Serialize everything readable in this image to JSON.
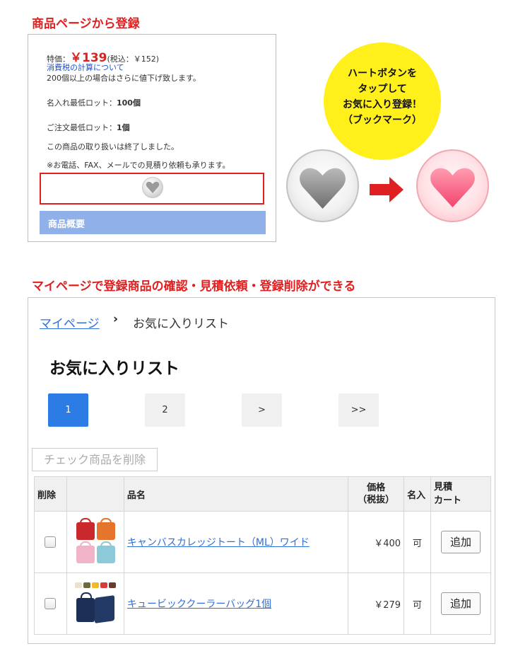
{
  "section1": {
    "heading": "商品ページから登録"
  },
  "product": {
    "price_label": "特価：",
    "price_value": "￥139",
    "price_tax": "(税込：￥152)",
    "tax_link": "消費税の計算について",
    "discount_note": "200個以上の場合はさらに値下げ致します。",
    "min_lot_name_label": "名入れ最低ロット：",
    "min_lot_name_value": "100個",
    "min_lot_order_label": "ご注文最低ロット：",
    "min_lot_order_value": "1個",
    "discontinued": "この商品の取り扱いは終了しました。",
    "estimate_note": "※お電話、FAX、メールでの見積り依頼も承ります。",
    "overview_label": "商品概要"
  },
  "callout": {
    "lines": [
      "ハートボタンを",
      "タップして",
      "お気に入り登録！",
      "（ブックマーク）"
    ]
  },
  "colors": {
    "accent_red": "#e02020",
    "link_blue": "#2f6fd8",
    "active_page": "#2d7be5",
    "callout_yellow": "#ffef1a"
  },
  "section2": {
    "heading": "マイページで登録商品の確認・見積依頼・登録削除ができる"
  },
  "breadcrumb": {
    "mypage": "マイページ",
    "separator": "›",
    "current": "お気に入りリスト"
  },
  "favorites": {
    "title": "お気に入りリスト",
    "pages": [
      "1",
      "2",
      ">",
      ">>"
    ],
    "active_page": "1",
    "delete_checked_label": "チェック商品を削除",
    "columns": {
      "delete": "削除",
      "image": "",
      "name": "品名",
      "price_line1": "価格",
      "price_line2": "（税抜）",
      "naire": "名入",
      "estimate_line1": "見積",
      "estimate_line2": "カート"
    },
    "rows": [
      {
        "name": "キャンバスカレッジトート（ML）ワイド",
        "price": "￥400",
        "naire": "可",
        "add_label": "追加"
      },
      {
        "name": "キュービッククーラーバッグ1個",
        "price": "￥279",
        "naire": "可",
        "add_label": "追加"
      }
    ]
  },
  "icons": {
    "small_heart": "heart-icon-gray",
    "gray_heart": "heart-icon-gray",
    "arrow": "arrow-right-icon",
    "pink_heart": "heart-icon-pink"
  }
}
